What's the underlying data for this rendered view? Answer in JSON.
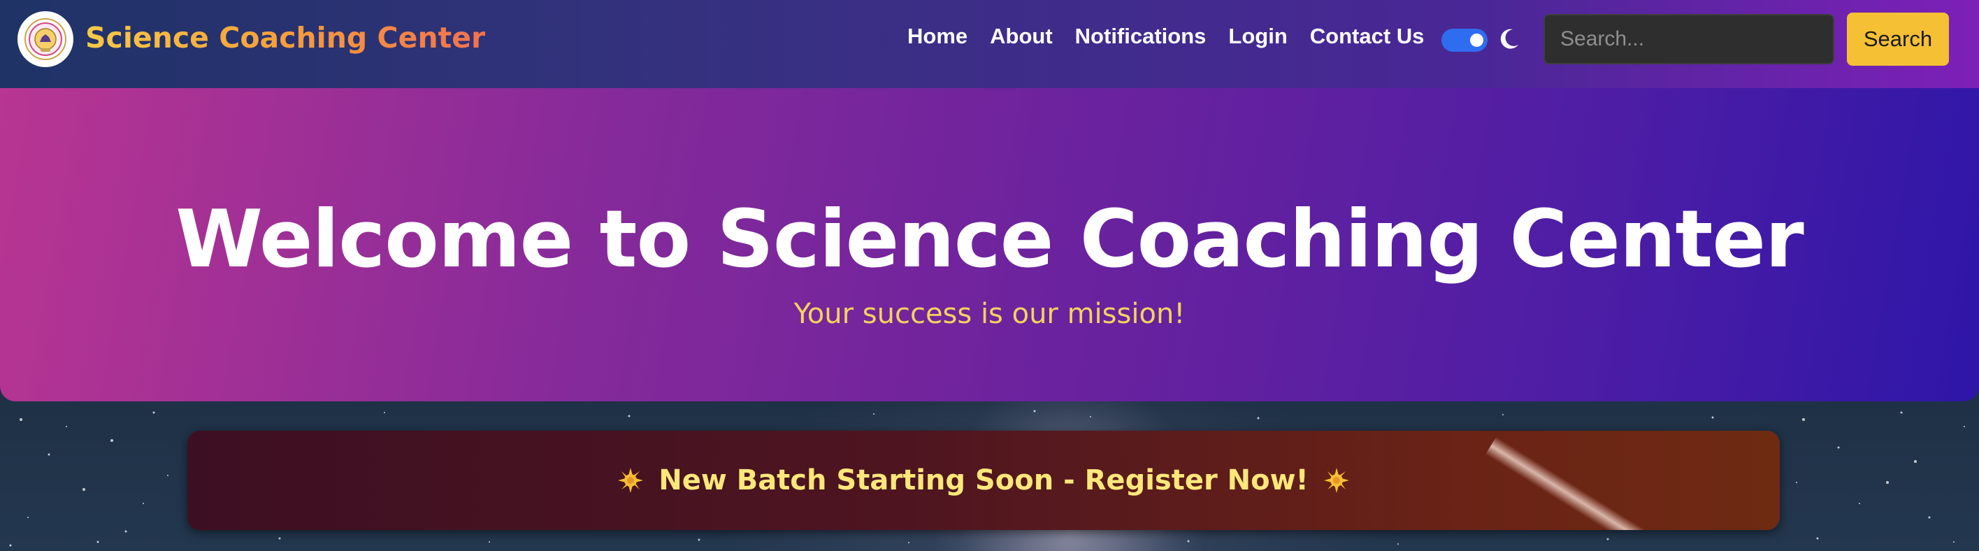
{
  "navbar": {
    "brand": "Science Coaching Center",
    "links": [
      "Home",
      "About",
      "Notifications",
      "Login",
      "Contact Us"
    ],
    "theme_toggle": "on",
    "search": {
      "placeholder": "Search...",
      "value": "",
      "button_label": "Search"
    }
  },
  "hero": {
    "title": "Welcome to Science Coaching Center",
    "subtitle": "Your success is our mission!"
  },
  "banner": {
    "text": "New Batch Starting Soon - Register Now!",
    "icon": "sparkle-icon"
  },
  "colors": {
    "accent": "#f5c034",
    "toggle": "#2f6df0",
    "banner_text": "#fce77a",
    "subtitle": "#f4d35e"
  }
}
